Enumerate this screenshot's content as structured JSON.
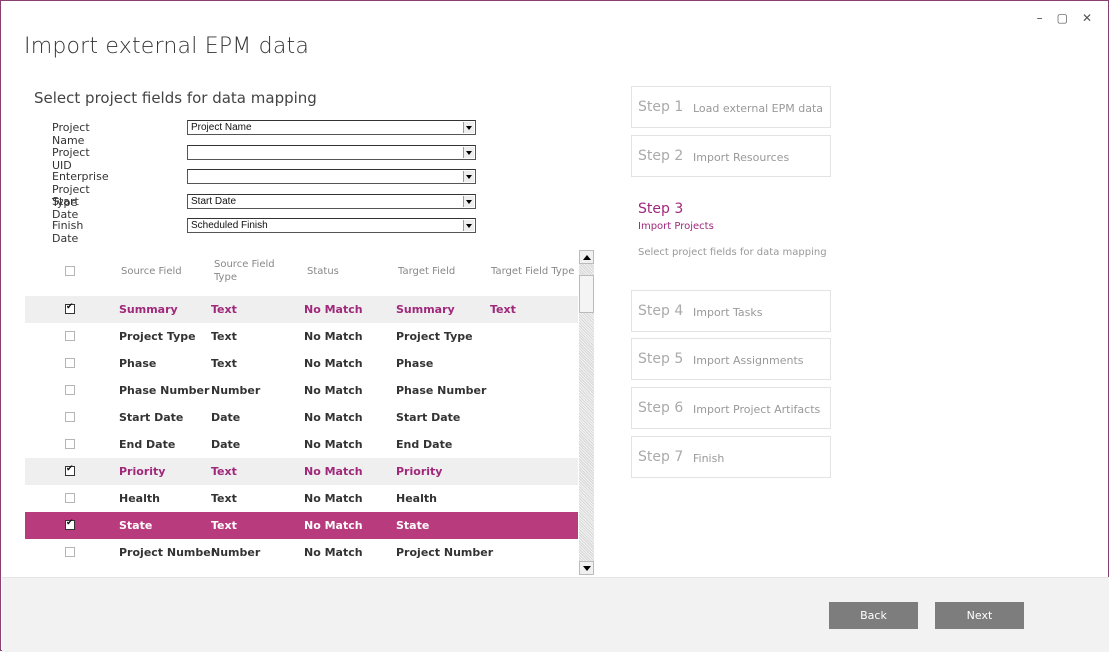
{
  "window": {
    "title": "Import external EPM data",
    "controls": [
      "–",
      "▢",
      "✕"
    ]
  },
  "subtitle": "Select project fields for data mapping",
  "fields": [
    {
      "label": "Project Name",
      "value": "Project Name"
    },
    {
      "label": "Project UID",
      "value": ""
    },
    {
      "label": "Enterprise Project Type",
      "value": ""
    },
    {
      "label": "Start Date",
      "value": "Start Date"
    },
    {
      "label": "Finish Date",
      "value": "Scheduled Finish"
    }
  ],
  "grid": {
    "headers": {
      "source_field": "Source Field",
      "source_field_type_1": "Source Field",
      "source_field_type_2": "Type",
      "status": "Status",
      "target_field": "Target Field",
      "target_field_type": "Target Field Type"
    },
    "rows": [
      {
        "checked": true,
        "source": "Summary",
        "type": "Text",
        "status": "No Match",
        "target": "Summary",
        "target_type": "Text",
        "style": "shaded pinkText"
      },
      {
        "checked": false,
        "source": "Project Type",
        "type": "Text",
        "status": "No Match",
        "target": "Project Type",
        "target_type": "",
        "style": ""
      },
      {
        "checked": false,
        "source": "Phase",
        "type": "Text",
        "status": "No Match",
        "target": "Phase",
        "target_type": "",
        "style": ""
      },
      {
        "checked": false,
        "source": "Phase Number",
        "type": "Number",
        "status": "No Match",
        "target": "Phase Number",
        "target_type": "",
        "style": ""
      },
      {
        "checked": false,
        "source": "Start Date",
        "type": "Date",
        "status": "No Match",
        "target": "Start Date",
        "target_type": "",
        "style": ""
      },
      {
        "checked": false,
        "source": "End Date",
        "type": "Date",
        "status": "No Match",
        "target": "End Date",
        "target_type": "",
        "style": ""
      },
      {
        "checked": true,
        "source": "Priority",
        "type": "Text",
        "status": "No Match",
        "target": "Priority",
        "target_type": "",
        "style": "shaded pinkText"
      },
      {
        "checked": false,
        "source": "Health",
        "type": "Text",
        "status": "No Match",
        "target": "Health",
        "target_type": "",
        "style": ""
      },
      {
        "checked": true,
        "source": "State",
        "type": "Text",
        "status": "No Match",
        "target": "State",
        "target_type": "",
        "style": "selected"
      },
      {
        "checked": false,
        "source": "Project Number",
        "type": "Number",
        "status": "No Match",
        "target": "Project Number",
        "target_type": "",
        "style": ""
      }
    ]
  },
  "steps": {
    "step1": {
      "num": "Step 1",
      "label": "Load external EPM data"
    },
    "step2": {
      "num": "Step 2",
      "label": "Import Resources"
    },
    "step3": {
      "num": "Step 3",
      "label": "Import Projects",
      "desc": "Select project fields for data mapping"
    },
    "step4": {
      "num": "Step 4",
      "label": "Import Tasks"
    },
    "step5": {
      "num": "Step 5",
      "label": "Import Assignments"
    },
    "step6": {
      "num": "Step 6",
      "label": "Import Project Artifacts"
    },
    "step7": {
      "num": "Step 7",
      "label": "Finish"
    }
  },
  "buttons": {
    "back": "Back",
    "next": "Next"
  },
  "colors": {
    "accent": "#b83b7e",
    "accent_text": "#a0287a",
    "button": "#7d7d7d"
  },
  "icons": {
    "minimize": "minimize-icon",
    "restore": "restore-icon",
    "close": "close-icon"
  }
}
